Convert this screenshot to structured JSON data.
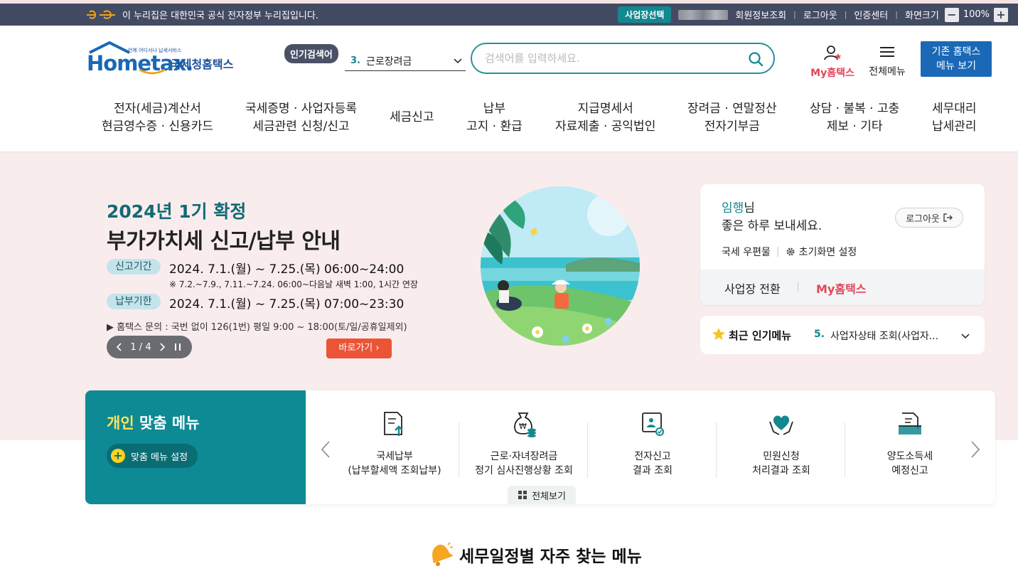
{
  "gov_bar": {
    "notice": "이 누리집은 대한민국 공식 전자정부 누리집입니다.",
    "biz_select": "사업장선택",
    "links": [
      "회원정보조회",
      "로그아웃",
      "인증센터",
      "화면크기"
    ],
    "zoom_minus": "−",
    "zoom_value": "100%",
    "zoom_plus": "+"
  },
  "header": {
    "logo_small": "언제 어디서나 납세서비스",
    "logo_main": "Hometax.",
    "logo_kr": "국세청홈택스",
    "popular_badge": "인기검색어",
    "popular_rank": "3.",
    "popular_value": "근로장려금",
    "search_placeholder": "검색어를 입력하세요.",
    "my_hometax": "My홈택스",
    "all_menu": "전체메뉴",
    "old_menu_line1": "기존 홈택스",
    "old_menu_line2": "메뉴 보기"
  },
  "gnb": [
    {
      "l1": "전자(세금)계산서",
      "l2": "현금영수증 · 신용카드"
    },
    {
      "l1": "국세증명 · 사업자등록",
      "l2": "세금관련 신청/신고"
    },
    {
      "l1": "세금신고",
      "l2": ""
    },
    {
      "l1": "납부",
      "l2": "고지 · 환급"
    },
    {
      "l1": "지급명세서",
      "l2": "자료제출 · 공익법인"
    },
    {
      "l1": "장려금 · 연말정산",
      "l2": "전자기부금"
    },
    {
      "l1": "상담 · 불복 · 고충",
      "l2": "제보 · 기타"
    },
    {
      "l1": "세무대리",
      "l2": "납세관리"
    }
  ],
  "hero": {
    "subtitle": "2024년 1기 확정",
    "title": "부가가치세 신고/납부 안내",
    "report_label": "신고기간",
    "report_period": "2024. 7.1.(월) ~ 7.25.(목) 06:00~24:00",
    "report_note": "※ 7.2.~7.9., 7.11.~7.24. 06:00~다음날 새벽 1:00, 1시간 연장",
    "pay_label": "납부기한",
    "pay_period": "2024. 7.1.(월) ~ 7.25.(목) 07:00~23:30",
    "inquiry": "▶ 홈택스 문의 : 국번 없이 126(1번) 평일 9:00 ~ 18:00(토/일/공휴일제외)",
    "pager": "1 / 4",
    "go_button": "바로가기"
  },
  "user_card": {
    "name": "임행님",
    "honorific": "님",
    "greeting": "좋은 하루 보내세요.",
    "logout": "로그아웃",
    "mailbox": "국세 우편물",
    "settings": "초기화면 설정",
    "switch_biz": "사업장 전환",
    "my_hometax": "My홈택스"
  },
  "recent": {
    "title": "최근 인기메뉴",
    "rank": "5.",
    "value": "사업자상태 조회(사업자..."
  },
  "personal_menu": {
    "title_hl": "개인",
    "title_rest": " 맞춤 메뉴",
    "setting": "맞춤 메뉴 설정",
    "items": [
      {
        "l1": "국세납부",
        "l2": "(납부할세액 조회납부)"
      },
      {
        "l1": "근로·자녀장려금",
        "l2": "정기 심사진행상황 조회"
      },
      {
        "l1": "전자신고",
        "l2": "결과 조회"
      },
      {
        "l1": "민원신청",
        "l2": "처리결과 조회"
      },
      {
        "l1": "양도소득세",
        "l2": "예정신고"
      }
    ],
    "view_all": "전체보기"
  },
  "schedule": {
    "title": "세무일정별 자주 찾는 메뉴"
  },
  "colors": {
    "teal": "#0d8a93",
    "hometax_blue": "#1a68b6",
    "my_pink": "#e3465b",
    "go_orange": "#ec5436",
    "gov_bar": "#434b63",
    "hero_bg": "#f9eced"
  }
}
